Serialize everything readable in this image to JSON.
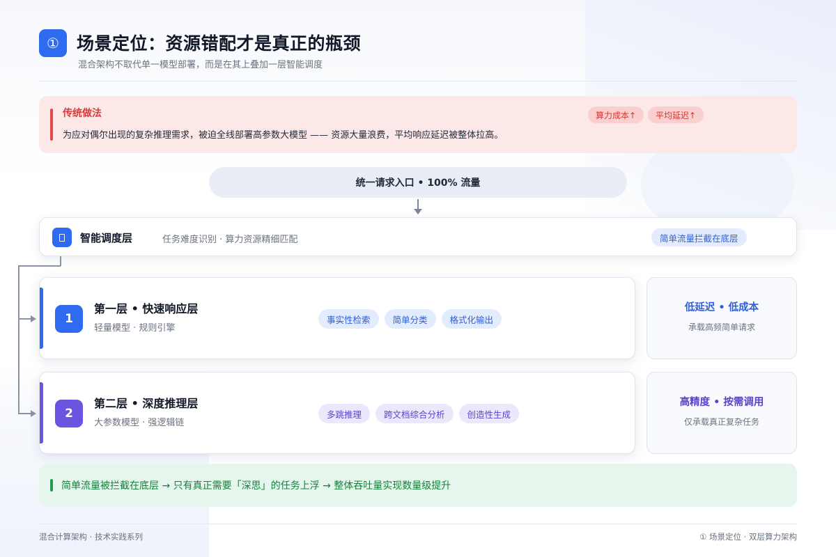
{
  "header": {
    "badge": "①",
    "title": "场景定位：资源错配才是真正的瓶颈",
    "subtitle": "混合架构不取代单一模型部署，而是在其上叠加一层智能调度"
  },
  "traditional": {
    "title": "传统做法",
    "description": "为应对偶尔出现的复杂推理需求，被迫全线部署高参数大模型 —— 资源大量浪费，平均响应延迟被整体拉高。",
    "tags": [
      "算力成本↑",
      "平均延迟↑"
    ]
  },
  "entry": {
    "label": "统一请求入口 • 100% 流量"
  },
  "scheduler": {
    "icon": "scheduler-icon",
    "title": "智能调度层",
    "description": "任务难度识别 · 算力资源精细匹配",
    "tag": "简单流量拦截在底层"
  },
  "layers": [
    {
      "number": "1",
      "title": "第一层 • 快速响应层",
      "description": "轻量模型 · 规则引擎",
      "chips": [
        "事实性检索",
        "简单分类",
        "格式化输出"
      ],
      "side_title": "低延迟 • 低成本",
      "side_desc": "承载高频简单请求",
      "accent": "#2f6bf0"
    },
    {
      "number": "2",
      "title": "第二层 • 深度推理层",
      "description": "大参数模型 · 强逻辑链",
      "chips": [
        "多跳推理",
        "跨文档综合分析",
        "创造性生成"
      ],
      "side_title": "高精度 • 按需调用",
      "side_desc": "仅承载真正复杂任务",
      "accent": "#6b54e0"
    }
  ],
  "banner": {
    "text": "简单流量被拦截在底层 → 只有真正需要「深思」的任务上浮 → 整体吞吐量实现数量级提升"
  },
  "footer": {
    "left": "混合计算架构 · 技术实践系列",
    "right": "① 场景定位 · 双层算力架构"
  },
  "colors": {
    "primary": "#2f6bf0",
    "purple": "#6b54e0",
    "danger": "#e14a4a",
    "success": "#1f9d55"
  }
}
